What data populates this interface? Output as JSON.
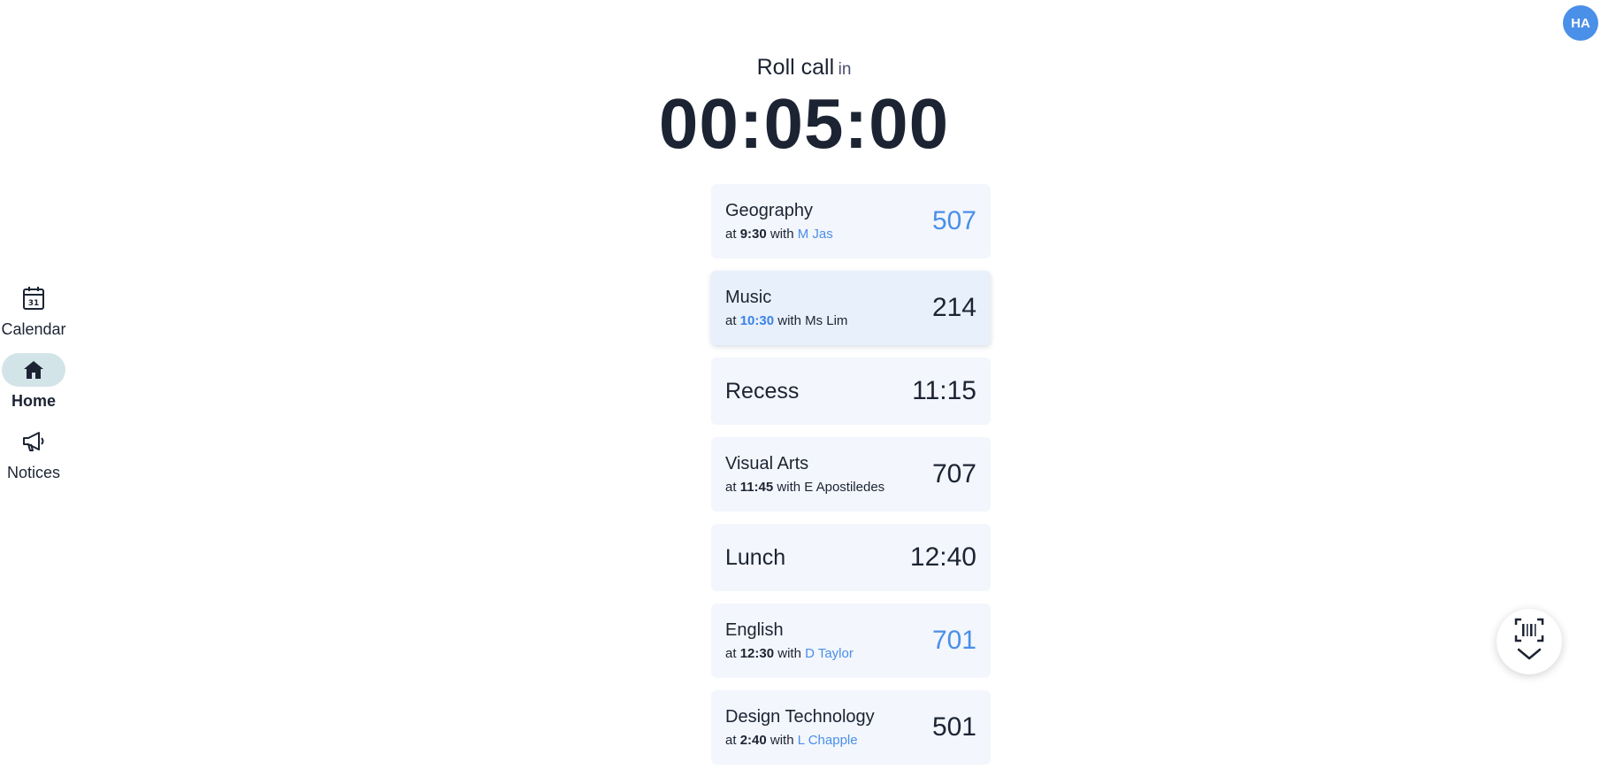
{
  "user": {
    "initials": "HA"
  },
  "nav": [
    {
      "label": "Calendar",
      "icon": "calendar-icon"
    },
    {
      "label": "Home",
      "icon": "home-icon",
      "active": true
    },
    {
      "label": "Notices",
      "icon": "megaphone-icon"
    }
  ],
  "header": {
    "event": "Roll call",
    "in": "in",
    "countdown": "00:05:00"
  },
  "periods": [
    {
      "name": "Geography",
      "at": "at",
      "time": "9:30",
      "with": "with",
      "teacher": "M Jas",
      "room": "507"
    },
    {
      "name": "Music",
      "at": "at",
      "time": "10:30",
      "with": "with",
      "teacher": "Ms Lim",
      "room": "214"
    },
    {
      "name": "Recess",
      "room": "11:15"
    },
    {
      "name": "Visual Arts",
      "at": "at",
      "time": "11:45",
      "with": "with",
      "teacher": "E Apostiledes",
      "room": "707"
    },
    {
      "name": "Lunch",
      "room": "12:40"
    },
    {
      "name": "English",
      "at": "at",
      "time": "12:30",
      "with": "with",
      "teacher": "D Taylor",
      "room": "701"
    },
    {
      "name": "Design Technology",
      "at": "at",
      "time": "2:40",
      "with": "with",
      "teacher": "L Chapple",
      "room": "501"
    }
  ],
  "colors": {
    "accent": "#4a8fe8",
    "card": "#f3f6fc",
    "active_nav": "#d3e4e8"
  },
  "fab": {
    "icon": "barcode-scan-icon",
    "chevron": "chevron-down-icon"
  }
}
